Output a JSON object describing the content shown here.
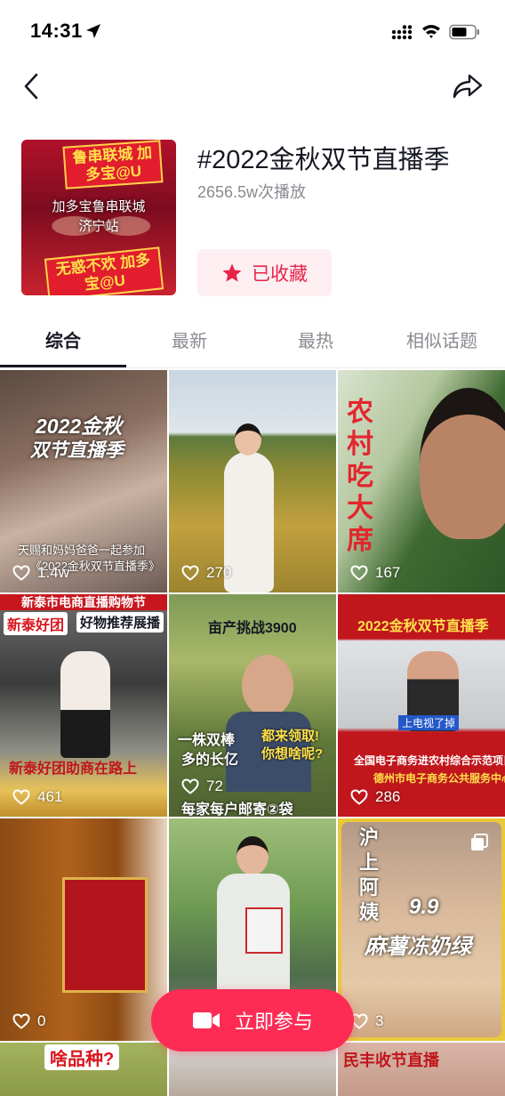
{
  "status_bar": {
    "time": "14:31"
  },
  "nav": {
    "back_icon": "chevron-left-icon",
    "share_icon": "share-arrow-icon"
  },
  "topic": {
    "title": "#2022金秋双节直播季",
    "play_count": "2656.5w次播放",
    "collect_label": "已收藏",
    "cover": {
      "top_text": "鲁串联城 加多宝@U",
      "mid_text_1": "加多宝鲁串联城",
      "mid_text_2": "济宁站",
      "bottom_text": "无惑不欢 加多宝@U"
    }
  },
  "tabs": [
    {
      "label": "综合",
      "active": true
    },
    {
      "label": "最新",
      "active": false
    },
    {
      "label": "最热",
      "active": false
    },
    {
      "label": "相似话题",
      "active": false
    }
  ],
  "videos": [
    {
      "likes": "1.4w",
      "caption_1": "2022金秋",
      "caption_2": "双节直播季",
      "sub_1": "天赐和妈妈爸爸一起参加",
      "sub_2": "《2022金秋双节直播季》"
    },
    {
      "likes": "270"
    },
    {
      "likes": "167",
      "caption_1": "农村吃大席"
    },
    {
      "likes": "461",
      "banner": "新泰市电商直播购物节",
      "caption_1": "新泰好团",
      "caption_2": "好物推荐展播",
      "caption_3": "新泰好团助商在路上"
    },
    {
      "likes": "72",
      "caption_1": "亩产挑战3900",
      "caption_2": "一株双棒",
      "caption_3": "多的长亿",
      "caption_4": "都来领取!",
      "caption_5": "你想啥呢?",
      "caption_6": "每家每户邮寄②袋"
    },
    {
      "likes": "286",
      "caption_1": "2022金秋双节直播季",
      "caption_2": "上电视了掉",
      "caption_3": "全国电子商务进农村综合示范项目",
      "caption_4": "德州市电子商务公共服务中心"
    },
    {
      "likes": "0"
    },
    {
      "likes": ""
    },
    {
      "likes": "3",
      "caption_1": "沪上阿姨",
      "caption_2": "9.9",
      "caption_3": "麻薯冻奶绿"
    },
    {
      "likes": "",
      "caption_1": "啥品种?"
    },
    {
      "likes": ""
    },
    {
      "likes": "",
      "caption_1": "民丰收节直播"
    }
  ],
  "join": {
    "label": "立即参与",
    "icon": "video-camera-icon"
  },
  "colors": {
    "accent": "#fe2c55",
    "collect_bg": "#fdeef1",
    "collect_text": "#e8244b"
  }
}
